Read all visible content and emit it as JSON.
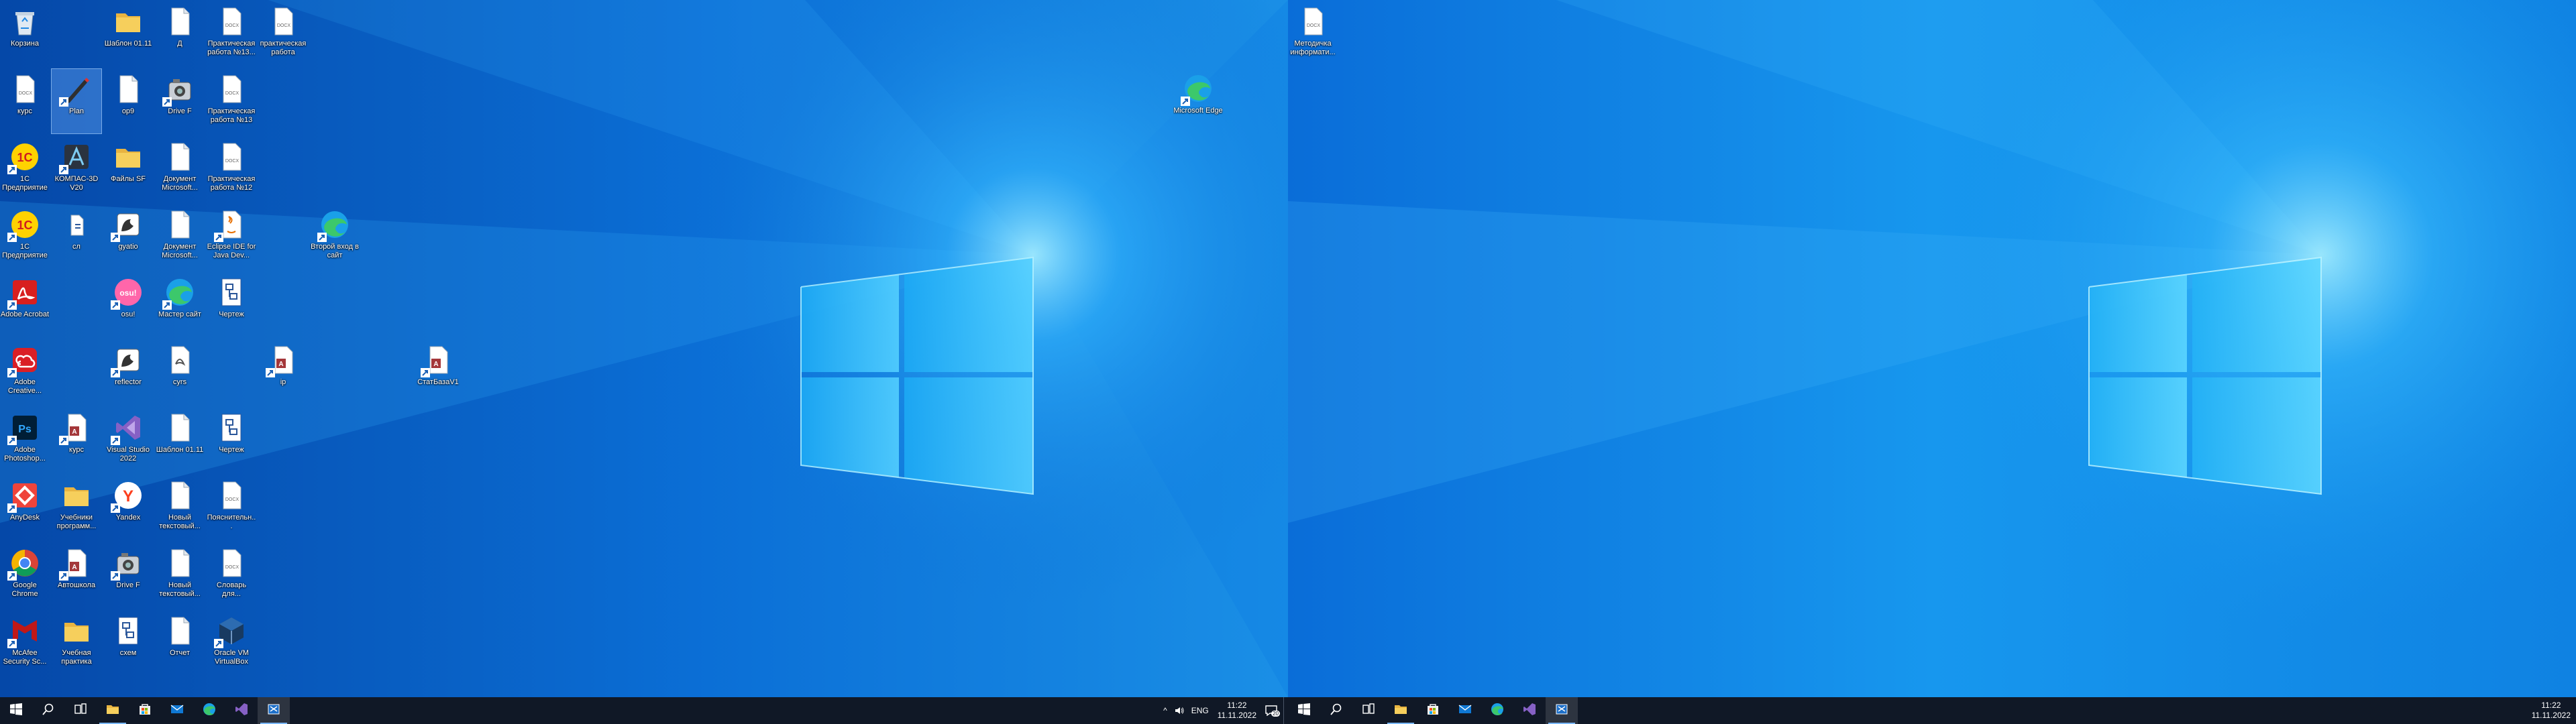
{
  "colors": {
    "taskbar": "#101826",
    "wallpaper_dark": "#0548a8",
    "wallpaper_light": "#19a6ee",
    "glow": "#9feaff"
  },
  "left_desktop": {
    "icons": [
      {
        "name": "recycle-bin",
        "label": "Корзина",
        "icon": "recycle-bin-icon",
        "col": 0,
        "row": 0,
        "type": "recycle"
      },
      {
        "name": "folder-1",
        "label": "Шаблон 01.11",
        "icon": "folder-icon",
        "col": 2,
        "row": 0,
        "type": "folder"
      },
      {
        "name": "file-1",
        "label": "Д",
        "icon": "document-icon",
        "col": 3,
        "row": 0,
        "type": "file"
      },
      {
        "name": "docx-1",
        "label": "Практическая работа №13...",
        "icon": "word-document-icon",
        "col": 4,
        "row": 0,
        "type": "docx"
      },
      {
        "name": "docx-2",
        "label": "практическая работа",
        "icon": "word-document-icon",
        "col": 5,
        "row": 0,
        "type": "docx"
      },
      {
        "name": "docx-3",
        "label": "курс",
        "icon": "word-document-icon",
        "col": 0,
        "row": 1,
        "type": "docx"
      },
      {
        "name": "pencil-app",
        "label": "Plan",
        "icon": "pencil-icon",
        "col": 1,
        "row": 1,
        "type": "pencil",
        "selected": true
      },
      {
        "name": "file-2",
        "label": "ор9",
        "icon": "document-icon",
        "col": 2,
        "row": 1,
        "type": "file"
      },
      {
        "name": "camera-1",
        "label": "Drive F",
        "icon": "camera-icon",
        "col": 3,
        "row": 1,
        "type": "camera"
      },
      {
        "name": "docx-4",
        "label": "Практическая работа №13",
        "icon": "word-document-icon",
        "col": 4,
        "row": 1,
        "type": "docx"
      },
      {
        "name": "onec-1",
        "label": "1С Предприятие",
        "icon": "onec-icon",
        "col": 0,
        "row": 2,
        "type": "onec"
      },
      {
        "name": "kompas",
        "label": "КОМПАС-3D V20",
        "icon": "kompas-icon",
        "col": 1,
        "row": 2,
        "type": "kompas"
      },
      {
        "name": "folder-2",
        "label": "Файлы SF",
        "icon": "folder-icon",
        "col": 2,
        "row": 2,
        "type": "folder"
      },
      {
        "name": "file-3",
        "label": "Документ Microsoft...",
        "icon": "document-icon",
        "col": 3,
        "row": 2,
        "type": "file"
      },
      {
        "name": "docx-5",
        "label": "Практическая работа №12",
        "icon": "word-document-icon",
        "col": 4,
        "row": 2,
        "type": "docx"
      },
      {
        "name": "onec-2",
        "label": "1С Предприятие",
        "icon": "onec-icon",
        "col": 0,
        "row": 3,
        "type": "onec"
      },
      {
        "name": "file-4",
        "label": "сл",
        "icon": "small-file-icon",
        "col": 1,
        "row": 3,
        "type": "small"
      },
      {
        "name": "app-1",
        "label": "gyatio",
        "icon": "app-icon",
        "col": 2,
        "row": 3,
        "type": "app"
      },
      {
        "name": "file-5",
        "label": "Документ Microsoft...",
        "icon": "document-icon",
        "col": 3,
        "row": 3,
        "type": "file"
      },
      {
        "name": "java-1",
        "label": "Eclipse IDE for Java Dev...",
        "icon": "java-icon",
        "col": 4,
        "row": 3,
        "type": "java"
      },
      {
        "name": "edge-2",
        "label": "Второй вход в сайт",
        "icon": "edge-icon",
        "col": 6,
        "row": 3,
        "type": "edge"
      },
      {
        "name": "acrobat",
        "label": "Adobe Acrobat",
        "icon": "acrobat-icon",
        "col": 0,
        "row": 4,
        "type": "acrobat"
      },
      {
        "name": "osu",
        "label": "osu!",
        "icon": "osu-icon",
        "col": 2,
        "row": 4,
        "type": "osu"
      },
      {
        "name": "edge-3",
        "label": "Мастер сайт",
        "icon": "edge-icon",
        "col": 3,
        "row": 4,
        "type": "edge"
      },
      {
        "name": "scheme-1",
        "label": "Чертеж",
        "icon": "scheme-icon",
        "col": 4,
        "row": 4,
        "type": "scheme"
      },
      {
        "name": "adobe-cc",
        "label": "Adobe Creative...",
        "icon": "creative-cloud-icon",
        "col": 0,
        "row": 5,
        "type": "cc"
      },
      {
        "name": "app-2",
        "label": "reflector",
        "icon": "app-icon",
        "col": 2,
        "row": 5,
        "type": "app"
      },
      {
        "name": "file-6",
        "label": "cyrs",
        "icon": "document-icon",
        "col": 3,
        "row": 5,
        "type": "pdf"
      },
      {
        "name": "access-1",
        "label": "ip",
        "icon": "access-icon",
        "col": 5,
        "row": 5,
        "type": "access"
      },
      {
        "name": "access-2",
        "label": "СтатБазаV1",
        "icon": "access-icon",
        "col": 8,
        "row": 5,
        "type": "access"
      },
      {
        "name": "photoshop",
        "label": "Adobe Photoshop...",
        "icon": "photoshop-icon",
        "col": 0,
        "row": 6,
        "type": "ps"
      },
      {
        "name": "access-3",
        "label": "курс",
        "icon": "access-icon",
        "col": 1,
        "row": 6,
        "type": "access"
      },
      {
        "name": "vs",
        "label": "Visual Studio 2022",
        "icon": "visual-studio-icon",
        "col": 2,
        "row": 6,
        "type": "vs"
      },
      {
        "name": "file-7",
        "label": "Шаблон 01.11",
        "icon": "document-icon",
        "col": 3,
        "row": 6,
        "type": "file"
      },
      {
        "name": "scheme-2",
        "label": "Чертеж",
        "icon": "scheme-icon",
        "col": 4,
        "row": 6,
        "type": "scheme"
      },
      {
        "name": "anydesk",
        "label": "AnyDesk",
        "icon": "anydesk-icon",
        "col": 0,
        "row": 7,
        "type": "anydesk"
      },
      {
        "name": "folder-3",
        "label": "Учебники программ...",
        "icon": "folder-icon",
        "col": 1,
        "row": 7,
        "type": "folder"
      },
      {
        "name": "yandex",
        "label": "Yandex",
        "icon": "yandex-icon",
        "col": 2,
        "row": 7,
        "type": "yandex"
      },
      {
        "name": "file-8",
        "label": "Новый текстовый...",
        "icon": "document-icon",
        "col": 3,
        "row": 7,
        "type": "file"
      },
      {
        "name": "docx-6",
        "label": "Пояснительн...",
        "icon": "word-document-icon",
        "col": 4,
        "row": 7,
        "type": "docx"
      },
      {
        "name": "chrome",
        "label": "Google Chrome",
        "icon": "chrome-icon",
        "col": 0,
        "row": 8,
        "type": "chrome"
      },
      {
        "name": "access-4",
        "label": "Автошкола",
        "icon": "access-icon",
        "col": 1,
        "row": 8,
        "type": "access"
      },
      {
        "name": "camera-2",
        "label": "Drive F",
        "icon": "camera-icon",
        "col": 2,
        "row": 8,
        "type": "camera"
      },
      {
        "name": "file-9",
        "label": "Новый текстовый...",
        "icon": "document-icon",
        "col": 3,
        "row": 8,
        "type": "file"
      },
      {
        "name": "docx-7",
        "label": "Словарь для...",
        "icon": "word-document-icon",
        "col": 4,
        "row": 8,
        "type": "docx"
      },
      {
        "name": "mcafee",
        "label": "McAfee Security Sc...",
        "icon": "mcafee-icon",
        "col": 0,
        "row": 9,
        "type": "mcafee"
      },
      {
        "name": "folder-4",
        "label": "Учебная практика",
        "icon": "folder-icon",
        "col": 1,
        "row": 9,
        "type": "folder"
      },
      {
        "name": "scheme-3",
        "label": "схем",
        "icon": "scheme-icon",
        "col": 2,
        "row": 9,
        "type": "scheme"
      },
      {
        "name": "file-10",
        "label": "Отчет",
        "icon": "document-icon",
        "col": 3,
        "row": 9,
        "type": "file"
      },
      {
        "name": "virtualbox",
        "label": "Oracle VM VirtualBox",
        "icon": "virtualbox-icon",
        "col": 4,
        "row": 9,
        "type": "vbox"
      }
    ],
    "edge_free": {
      "name": "edge-desktop",
      "label": "Microsoft Edge",
      "icon": "edge-icon"
    }
  },
  "right_desktop": {
    "icons": [
      {
        "name": "docx-right",
        "label": "Методичка информати...",
        "icon": "word-document-icon",
        "type": "docx"
      }
    ]
  },
  "taskbar_left": {
    "buttons": [
      {
        "name": "start-button",
        "icon": "windows-logo-icon"
      },
      {
        "name": "search-button",
        "icon": "search-icon"
      },
      {
        "name": "task-view-button",
        "icon": "task-view-icon"
      },
      {
        "name": "explorer-button",
        "icon": "folder-icon",
        "running": true
      },
      {
        "name": "store-button",
        "icon": "store-icon"
      },
      {
        "name": "mail-button",
        "icon": "mail-icon"
      },
      {
        "name": "edge-button",
        "icon": "edge-icon"
      },
      {
        "name": "visual-studio-button",
        "icon": "visual-studio-icon"
      },
      {
        "name": "snip-button",
        "icon": "snipping-tool-icon",
        "running": true,
        "active": true
      }
    ],
    "tray": {
      "chevron": "^",
      "lang": "ENG",
      "time": "11:22",
      "date": "11.11.2022",
      "notifications": "20"
    }
  },
  "taskbar_right": {
    "buttons": [
      {
        "name": "start-button",
        "icon": "windows-logo-icon"
      },
      {
        "name": "search-button",
        "icon": "search-icon"
      },
      {
        "name": "task-view-button",
        "icon": "task-view-icon"
      },
      {
        "name": "explorer-button",
        "icon": "folder-icon",
        "running": true
      },
      {
        "name": "store-button",
        "icon": "store-icon"
      },
      {
        "name": "mail-button",
        "icon": "mail-icon"
      },
      {
        "name": "edge-button",
        "icon": "edge-icon"
      },
      {
        "name": "visual-studio-button",
        "icon": "visual-studio-icon"
      },
      {
        "name": "snip-button",
        "icon": "snipping-tool-icon",
        "running": true,
        "active": true
      }
    ],
    "tray": {
      "time": "11:22",
      "date": "11.11.2022"
    }
  }
}
